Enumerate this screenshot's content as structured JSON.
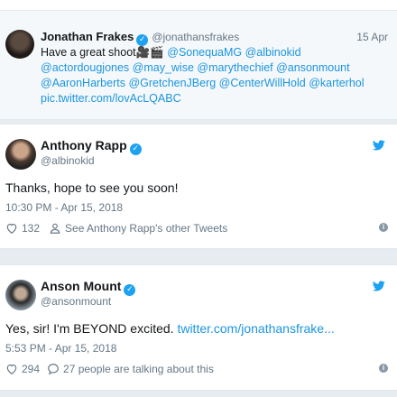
{
  "quote_tweet": {
    "name": "Jonathan Frakes",
    "handle": "@jonathansfrakes",
    "date": "15 Apr",
    "text_prefix": "Have a great shoot",
    "emoji": "🎥🎬",
    "mentions_line1": "@SonequaMG @albinokid",
    "mentions_line2": "@actordougjones @may_wise @marythechief @ansonmount",
    "mentions_line3": "@AaronHarberts @GretchenJBerg @CenterWillHold @karterhol",
    "link": "pic.twitter.com/lovAcLQABC"
  },
  "tweets": [
    {
      "name": "Anthony Rapp",
      "handle": "@albinokid",
      "text": "Thanks, hope to see you soon!",
      "time": "10:30 PM - Apr 15, 2018",
      "likes": "132",
      "secondary_action": "See Anthony Rapp's other Tweets"
    },
    {
      "name": "Anson Mount",
      "handle": "@ansonmount",
      "text": "Yes, sir!  I'm BEYOND excited.",
      "link": "twitter.com/jonathansfrake...",
      "time": "5:53 PM - Apr 15, 2018",
      "likes": "294",
      "secondary_action": "27 people are talking about this"
    }
  ],
  "icons": {
    "verified": "verified-badge-icon",
    "twitter": "twitter-bird-icon",
    "like": "heart-icon",
    "profile": "person-icon",
    "reply": "speech-bubble-icon",
    "info": "info-icon"
  },
  "colors": {
    "accent": "#1da1f2",
    "link": "#1b95e0",
    "muted": "#657786",
    "background": "#e6ecf0"
  }
}
